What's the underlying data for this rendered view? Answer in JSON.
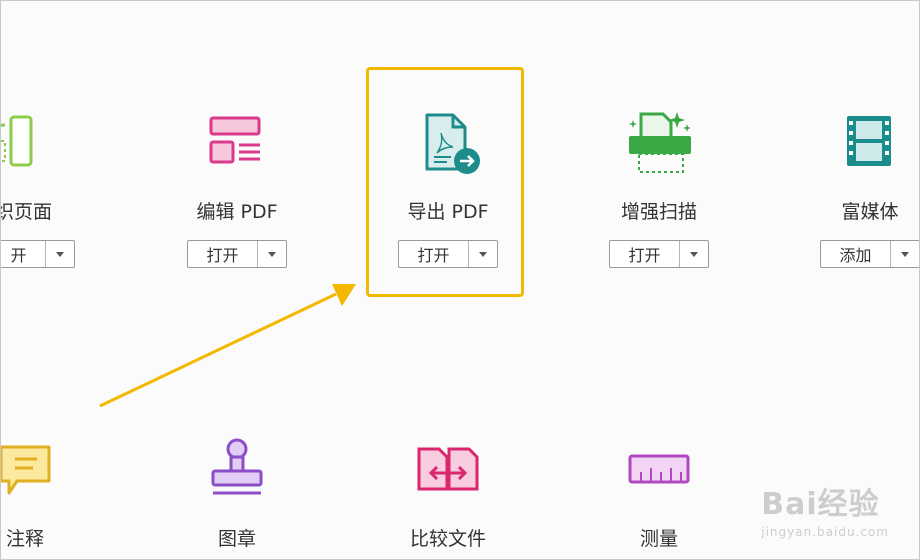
{
  "tools_row1": [
    {
      "name": "组织页面",
      "action": "打开"
    },
    {
      "name": "编辑 PDF",
      "action": "打开"
    },
    {
      "name": "导出 PDF",
      "action": "打开"
    },
    {
      "name": "增强扫描",
      "action": "打开"
    },
    {
      "name": "富媒体",
      "action": "添加"
    }
  ],
  "tools_row2": [
    {
      "name": "注释"
    },
    {
      "name": "图章"
    },
    {
      "name": "比较文件"
    },
    {
      "name": "测量"
    }
  ],
  "visible_crop": {
    "organize_label": "织页面",
    "organize_button": "开",
    "comment_label": "注释"
  },
  "watermark": {
    "brand": "Bai经验",
    "site": "jingyan.baidu.com"
  },
  "colors": {
    "highlight": "#f5b800",
    "arrow": "#f5b800",
    "export_icon": "#1f8c8c",
    "edit_icon": "#d93a8c",
    "scan_icon": "#3aa845",
    "media_icon": "#1a8c8c",
    "stamp_icon": "#8c4dc8",
    "compare_icon": "#d9266e",
    "measure_icon": "#b048c0",
    "comment_icon": "#e0b020"
  }
}
